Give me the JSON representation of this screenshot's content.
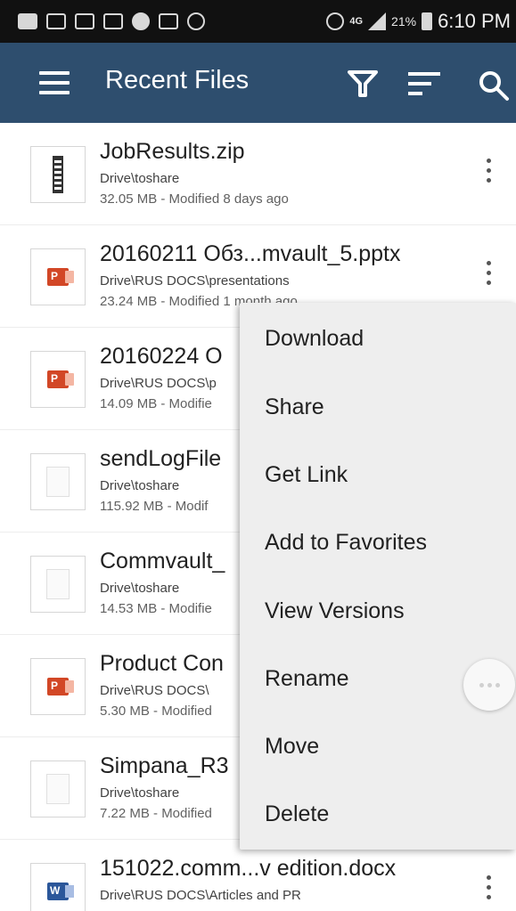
{
  "status_bar": {
    "network": "4G",
    "battery": "21%",
    "time": "6:10 PM"
  },
  "app_bar": {
    "title": "Recent Files",
    "menu_icon": "hamburger-icon",
    "filter_icon": "filter-icon",
    "sort_icon": "sort-icon",
    "search_icon": "search-icon",
    "background": "#2e4e6e"
  },
  "files": [
    {
      "name": "JobResults.zip",
      "path": "Drive\\toshare",
      "meta": "32.05 MB - Modified 8 days ago",
      "type": "zip"
    },
    {
      "name": "20160211 Обз...mvault_5.pptx",
      "path": "Drive\\RUS DOCS\\presentations",
      "meta": "23.24 MB - Modified 1 month ago",
      "type": "pptx"
    },
    {
      "name": "20160224 O",
      "path": "Drive\\RUS DOCS\\p",
      "meta": "14.09 MB - Modifie",
      "type": "pptx"
    },
    {
      "name": "sendLogFile",
      "path": "Drive\\toshare",
      "meta": "115.92 MB - Modif",
      "type": "generic"
    },
    {
      "name": "Commvault_",
      "path": "Drive\\toshare",
      "meta": "14.53 MB - Modifie",
      "type": "generic"
    },
    {
      "name": "Product Con",
      "path": "Drive\\RUS DOCS\\",
      "meta": "5.30 MB - Modified",
      "type": "pptx"
    },
    {
      "name": "Simpana_R3",
      "path": "Drive\\toshare",
      "meta": "7.22 MB - Modified",
      "type": "generic"
    },
    {
      "name": "151022.comm...v edition.docx",
      "path": "Drive\\RUS DOCS\\Articles and PR",
      "meta": "",
      "type": "docx"
    }
  ],
  "context_menu": {
    "items": [
      "Download",
      "Share",
      "Get Link",
      "Add to Favorites",
      "View Versions",
      "Rename",
      "Move",
      "Delete"
    ]
  },
  "icons": {
    "more": "more-vert-icon",
    "pptx": "powerpoint-icon",
    "docx": "word-icon",
    "zip": "zip-icon",
    "generic": "document-icon"
  },
  "colors": {
    "app_bar": "#2e4e6e",
    "powerpoint": "#d24726",
    "word": "#2b579a",
    "menu_bg": "#eeeeee"
  }
}
